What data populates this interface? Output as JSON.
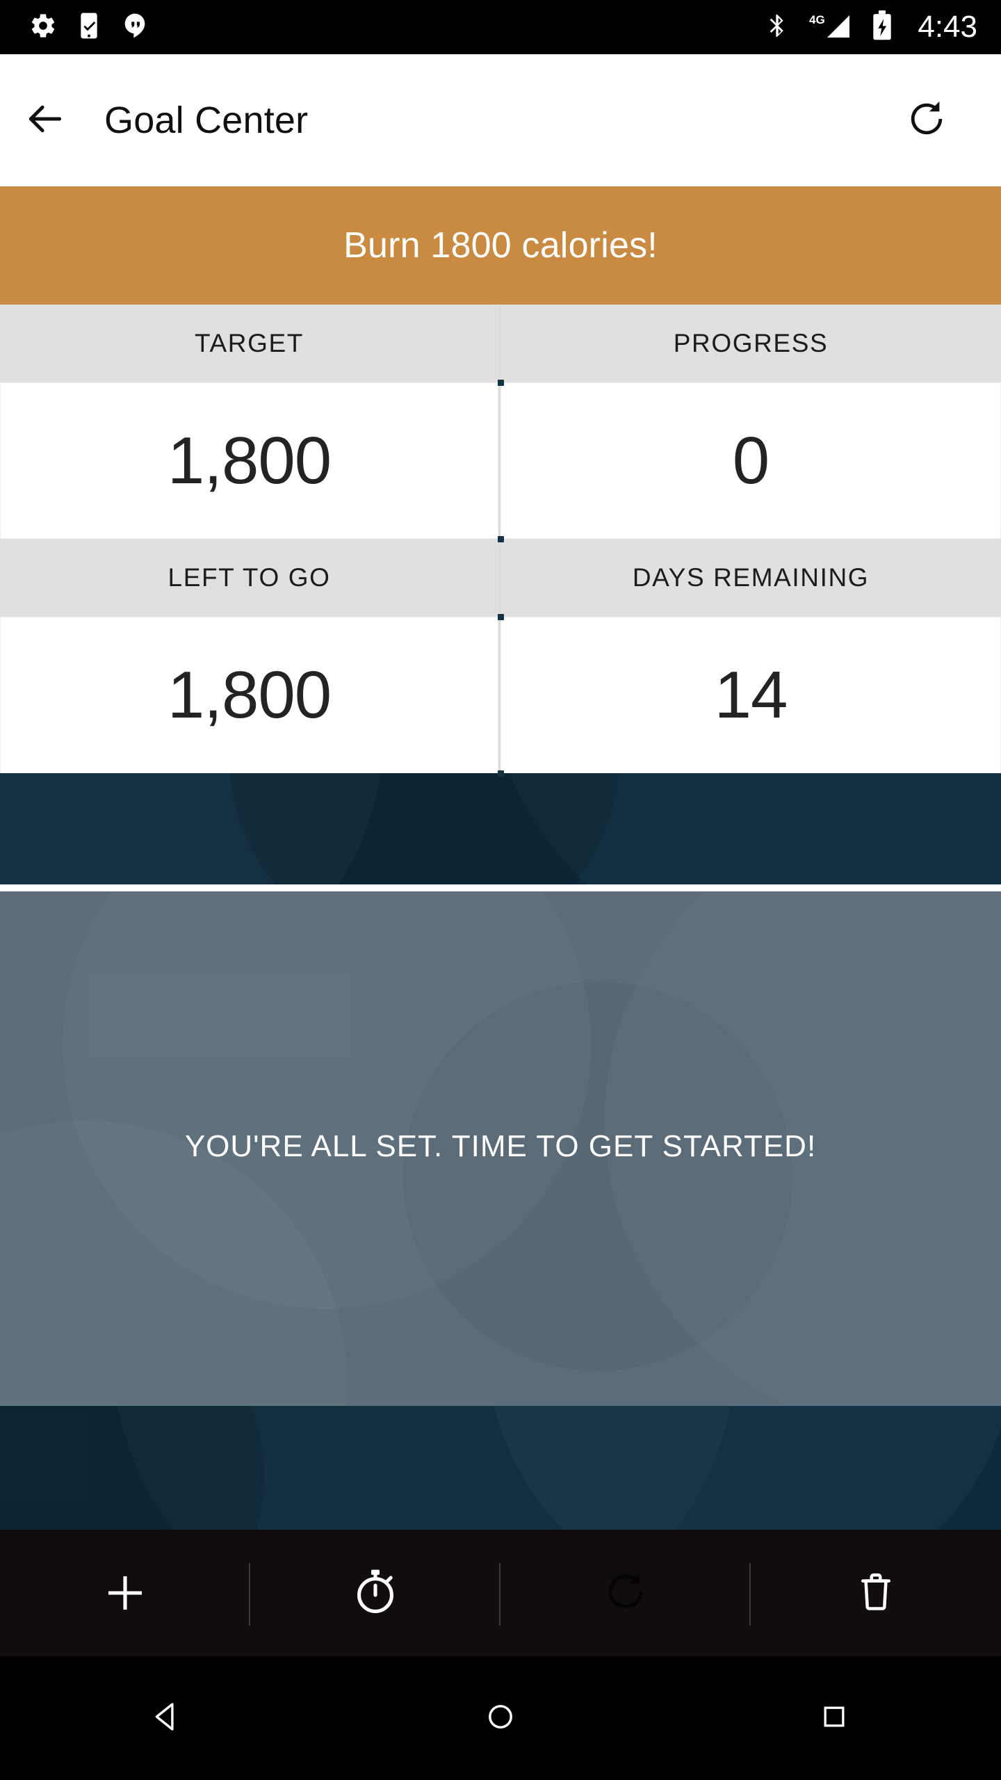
{
  "statusbar": {
    "time": "4:43",
    "left_icons": [
      "settings-gear-icon",
      "phone-check-icon",
      "hangouts-icon"
    ],
    "right_icons": [
      "bluetooth-icon",
      "signal-4g-icon",
      "battery-charging-icon"
    ],
    "network_label": "4G"
  },
  "appbar": {
    "back_icon": "back-arrow-icon",
    "title": "Goal Center",
    "refresh_icon": "refresh-icon"
  },
  "banner": {
    "text": "Burn 1800 calories!",
    "color": "#c98b42"
  },
  "stats": {
    "rows": [
      {
        "cells": [
          {
            "label": "TARGET",
            "value": "1,800"
          },
          {
            "label": "PROGRESS",
            "value": "0"
          }
        ]
      },
      {
        "cells": [
          {
            "label": "LEFT TO GO",
            "value": "1,800"
          },
          {
            "label": "DAYS REMAINING",
            "value": "14"
          }
        ]
      }
    ]
  },
  "hero": {
    "message": "YOU'RE ALL SET. TIME TO GET STARTED!",
    "navy_color": "#0d2a3c",
    "overlay_color": "#5b6c7a"
  },
  "toolbar": {
    "items": [
      {
        "name": "add-icon",
        "label": "+"
      },
      {
        "name": "timer-icon",
        "label": ""
      },
      {
        "name": "refresh-icon",
        "label": ""
      },
      {
        "name": "delete-icon",
        "label": ""
      }
    ]
  },
  "navbar": {
    "items": [
      "nav-back-icon",
      "nav-home-icon",
      "nav-recents-icon"
    ]
  }
}
